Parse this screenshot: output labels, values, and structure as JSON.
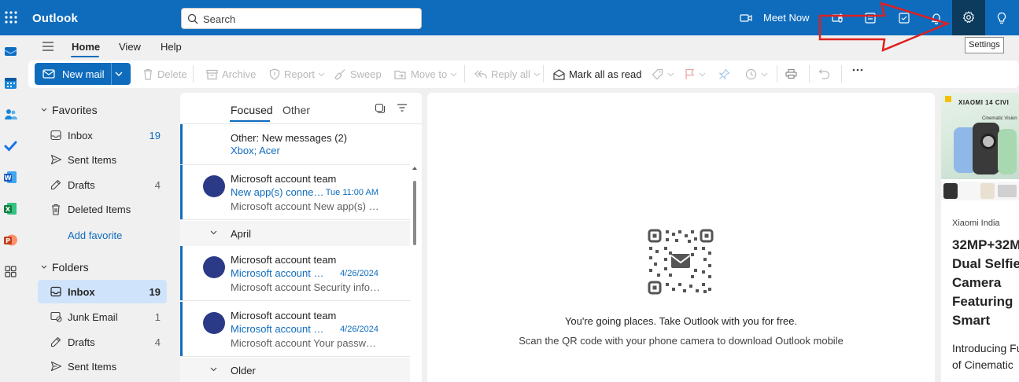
{
  "header": {
    "brand": "Outlook",
    "search_placeholder": "Search",
    "meet_now": "Meet Now",
    "settings_tooltip": "Settings",
    "accent": "#0f6cbd"
  },
  "ribbon": {
    "tabs": [
      "Home",
      "View",
      "Help"
    ],
    "active_tab": "Home",
    "new_mail": "New mail",
    "actions": {
      "delete": "Delete",
      "archive": "Archive",
      "report": "Report",
      "sweep": "Sweep",
      "move_to": "Move to",
      "reply_all": "Reply all",
      "mark_all_read": "Mark all as read"
    }
  },
  "favorites": {
    "title": "Favorites",
    "items": [
      {
        "label": "Inbox",
        "count": "19",
        "icon": "inbox-icon"
      },
      {
        "label": "Sent Items",
        "count": "",
        "icon": "send-icon"
      },
      {
        "label": "Drafts",
        "count": "4",
        "icon": "pencil-icon"
      },
      {
        "label": "Deleted Items",
        "count": "",
        "icon": "trash-icon"
      }
    ],
    "add_favorite": "Add favorite"
  },
  "folders": {
    "title": "Folders",
    "items": [
      {
        "label": "Inbox",
        "count": "19",
        "selected": true
      },
      {
        "label": "Junk Email",
        "count": "1"
      },
      {
        "label": "Drafts",
        "count": "4"
      },
      {
        "label": "Sent Items",
        "count": ""
      }
    ]
  },
  "message_list": {
    "tabs": [
      "Focused",
      "Other"
    ],
    "other_banner": {
      "title": "Other: New messages (2)",
      "senders": "Xbox; Acer"
    },
    "messages": [
      {
        "sender": "Microsoft account team",
        "subject": "New app(s) connected to your Microsoft account",
        "date": "Tue 11:00 AM",
        "preview": "Microsoft account New app(s) have access to your data"
      },
      {
        "sender": "Microsoft account team",
        "subject": "Microsoft account security info was added",
        "date": "4/26/2024",
        "preview": "Microsoft account Security info was added"
      },
      {
        "sender": "Microsoft account team",
        "subject": "Microsoft account password change",
        "date": "4/26/2024",
        "preview": "Microsoft account Your password changed"
      }
    ],
    "groups": [
      "April",
      "Older"
    ]
  },
  "reading_pane": {
    "promo_title": "You're going places. Take Outlook with you for free.",
    "promo_subtitle": "Scan the QR code with your phone camera to download Outlook mobile"
  },
  "ad": {
    "banner_title": "XIAOMI 14 CIVI",
    "banner_sub": "Cinematic Vision",
    "sponsor": "Xiaomi India",
    "headline": "32MP+32MP Dual Selfie Camera Featuring Smart",
    "body": "Introducing Future of Cinematic"
  }
}
